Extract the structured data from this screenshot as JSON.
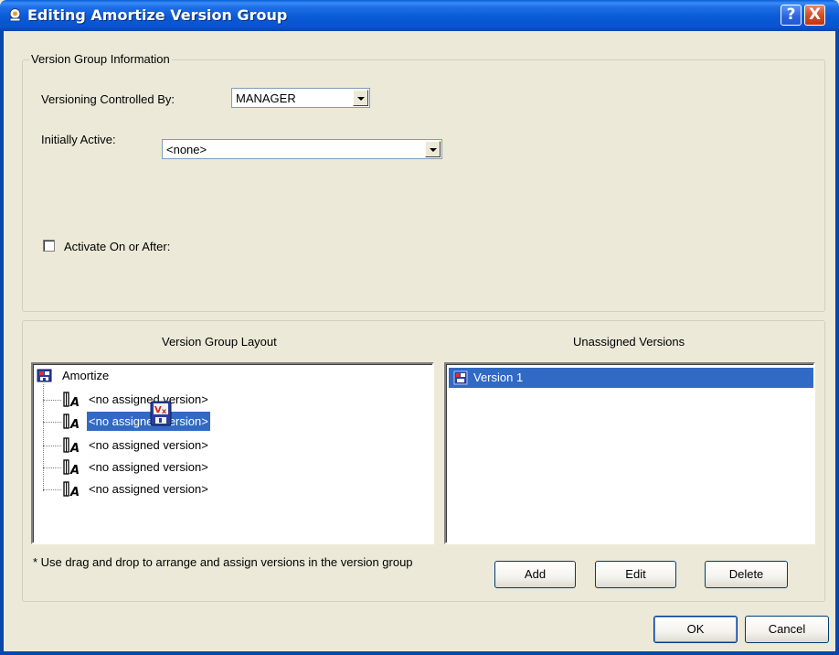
{
  "window": {
    "title": "Editing Amortize Version Group",
    "help_label": "?",
    "close_label": "X"
  },
  "info_group": {
    "legend": "Version Group Information",
    "controlled_by_label": "Versioning Controlled By:",
    "controlled_by_value": "MANAGER",
    "initially_active_label": "Initially Active:",
    "initially_active_value": "<none>",
    "activate_label": "Activate On or After:",
    "activate_checked": false
  },
  "layout": {
    "left_header": "Version Group Layout",
    "right_header": "Unassigned Versions",
    "tree_root": "Amortize",
    "tree_items": [
      "<no assigned version>",
      "<no assigned version>",
      "<no assigned version>",
      "<no assigned version>",
      "<no assigned version>"
    ],
    "selected_tree_index": 1,
    "unassigned": [
      "Version 1"
    ],
    "hint": "* Use drag and drop to arrange and assign versions in the version group",
    "add_label": "Add",
    "edit_label": "Edit",
    "delete_label": "Delete"
  },
  "footer": {
    "ok_label": "OK",
    "cancel_label": "Cancel"
  },
  "icons": {
    "title": "app-icon",
    "tree_root": "database-icon",
    "tree_item": "version-slot-icon",
    "drag": "drag-version-icon",
    "list_item": "version-icon"
  },
  "colors": {
    "titlebar": "#0a5ad6",
    "selection": "#316ac5",
    "dialog_bg": "#ece9d8"
  }
}
